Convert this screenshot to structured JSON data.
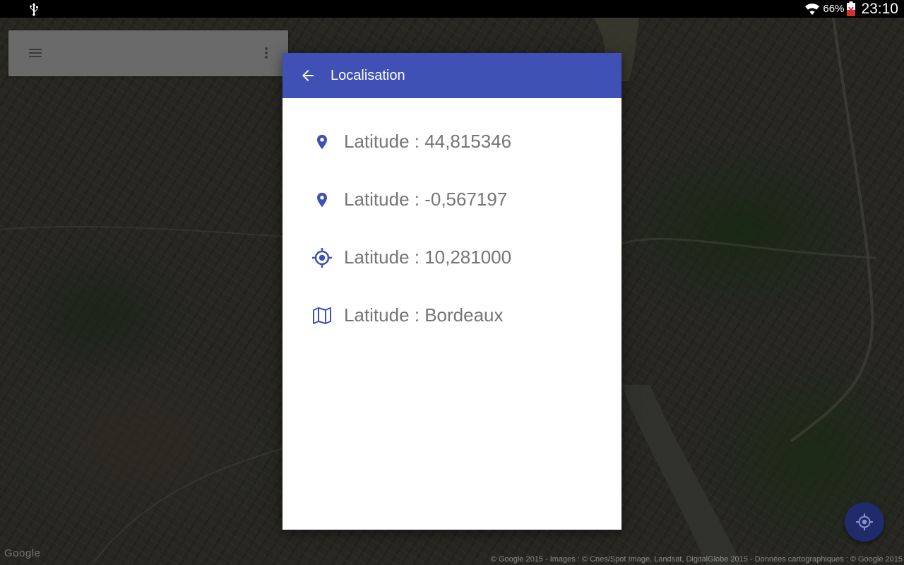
{
  "status_bar": {
    "battery_percent": "66%",
    "time": "23:10",
    "icons": [
      "usb-icon",
      "wifi-icon",
      "battery-icon"
    ]
  },
  "map": {
    "logo": "Google",
    "attribution": "© Google 2015 - Images : © Cnes/Spot Image, Landsat, DigitalGlobe 2015 - Données cartographiques : © Google 2015",
    "toolbar_icons": [
      "menu-icon",
      "more-vert-icon"
    ],
    "fab_icon": "my-location-icon"
  },
  "dialog": {
    "title": "Localisation",
    "back_icon": "arrow-back-icon",
    "rows": [
      {
        "icon": "place-icon",
        "text": "Latitude : 44,815346"
      },
      {
        "icon": "place-icon",
        "text": "Latitude : -0,567197"
      },
      {
        "icon": "gps-fixed-icon",
        "text": "Latitude : 10,281000"
      },
      {
        "icon": "map-icon",
        "text": "Latitude : Bordeaux"
      }
    ]
  },
  "colors": {
    "primary": "#3f51b5",
    "icon_tint": "#3f51b5",
    "row_text": "#757575",
    "fab": "#1f2b6b"
  }
}
